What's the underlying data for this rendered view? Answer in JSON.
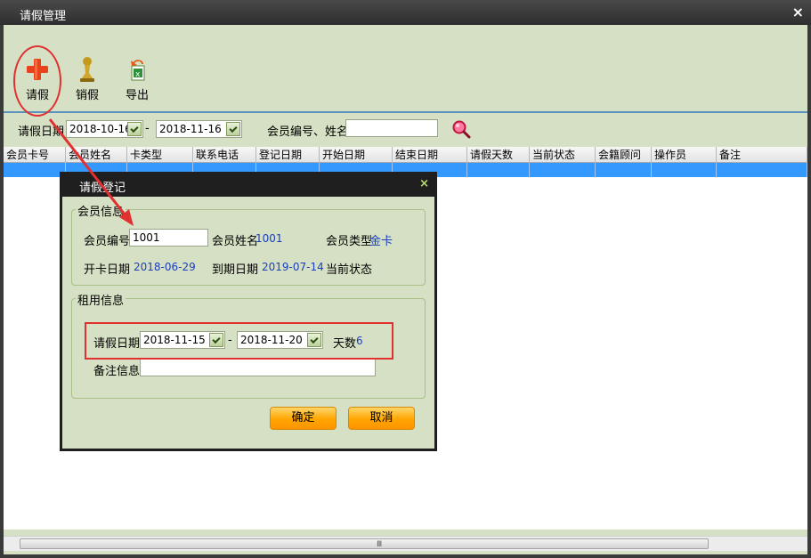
{
  "window": {
    "title": "请假管理",
    "close_glyph": "×"
  },
  "toolbar": {
    "items": [
      {
        "label": "请假",
        "icon": "plus-icon"
      },
      {
        "label": "销假",
        "icon": "pawn-icon"
      },
      {
        "label": "导出",
        "icon": "export-excel-icon"
      }
    ]
  },
  "filter": {
    "date_label": "请假日期",
    "date_from": "2018-10-16",
    "date_sep": "-",
    "date_to": "2018-11-16",
    "member_label": "会员编号、姓名",
    "member_value": ""
  },
  "grid": {
    "columns": [
      "会员卡号",
      "会员姓名",
      "卡类型",
      "联系电话",
      "登记日期",
      "开始日期",
      "结束日期",
      "请假天数",
      "当前状态",
      "会籍顾问",
      "操作员",
      "备注"
    ],
    "rows": [
      [
        "",
        "",
        "",
        "",
        "",
        "",
        "",
        "",
        "",
        "",
        "",
        ""
      ]
    ],
    "scroll_grip": "Ⅲ"
  },
  "dialog": {
    "title": "请假登记",
    "close_glyph": "×",
    "member_group": {
      "title": "会员信息",
      "member_no_label": "会员编号",
      "member_no_value": "1001",
      "member_name_label": "会员姓名",
      "member_name_value": "1001",
      "member_type_label": "会员类型",
      "member_type_value": "金卡",
      "open_date_label": "开卡日期",
      "open_date_value": "2018-06-29",
      "expire_label": "到期日期",
      "expire_value": "2019-07-14",
      "status_label": "当前状态",
      "status_value": ""
    },
    "leave_group": {
      "title": "租用信息",
      "date_label": "请假日期",
      "date_from": "2018-11-15",
      "date_sep": "-",
      "date_to": "2018-11-20",
      "days_label": "天数",
      "days_value": "6",
      "remark_label": "备注信息",
      "remark_value": ""
    },
    "ok_label": "确定",
    "cancel_label": "取消"
  },
  "colors": {
    "accent_red": "#e03030",
    "selection_blue": "#3399ff",
    "panel_green": "#d6e0c4",
    "button_orange": "#ffa500"
  }
}
